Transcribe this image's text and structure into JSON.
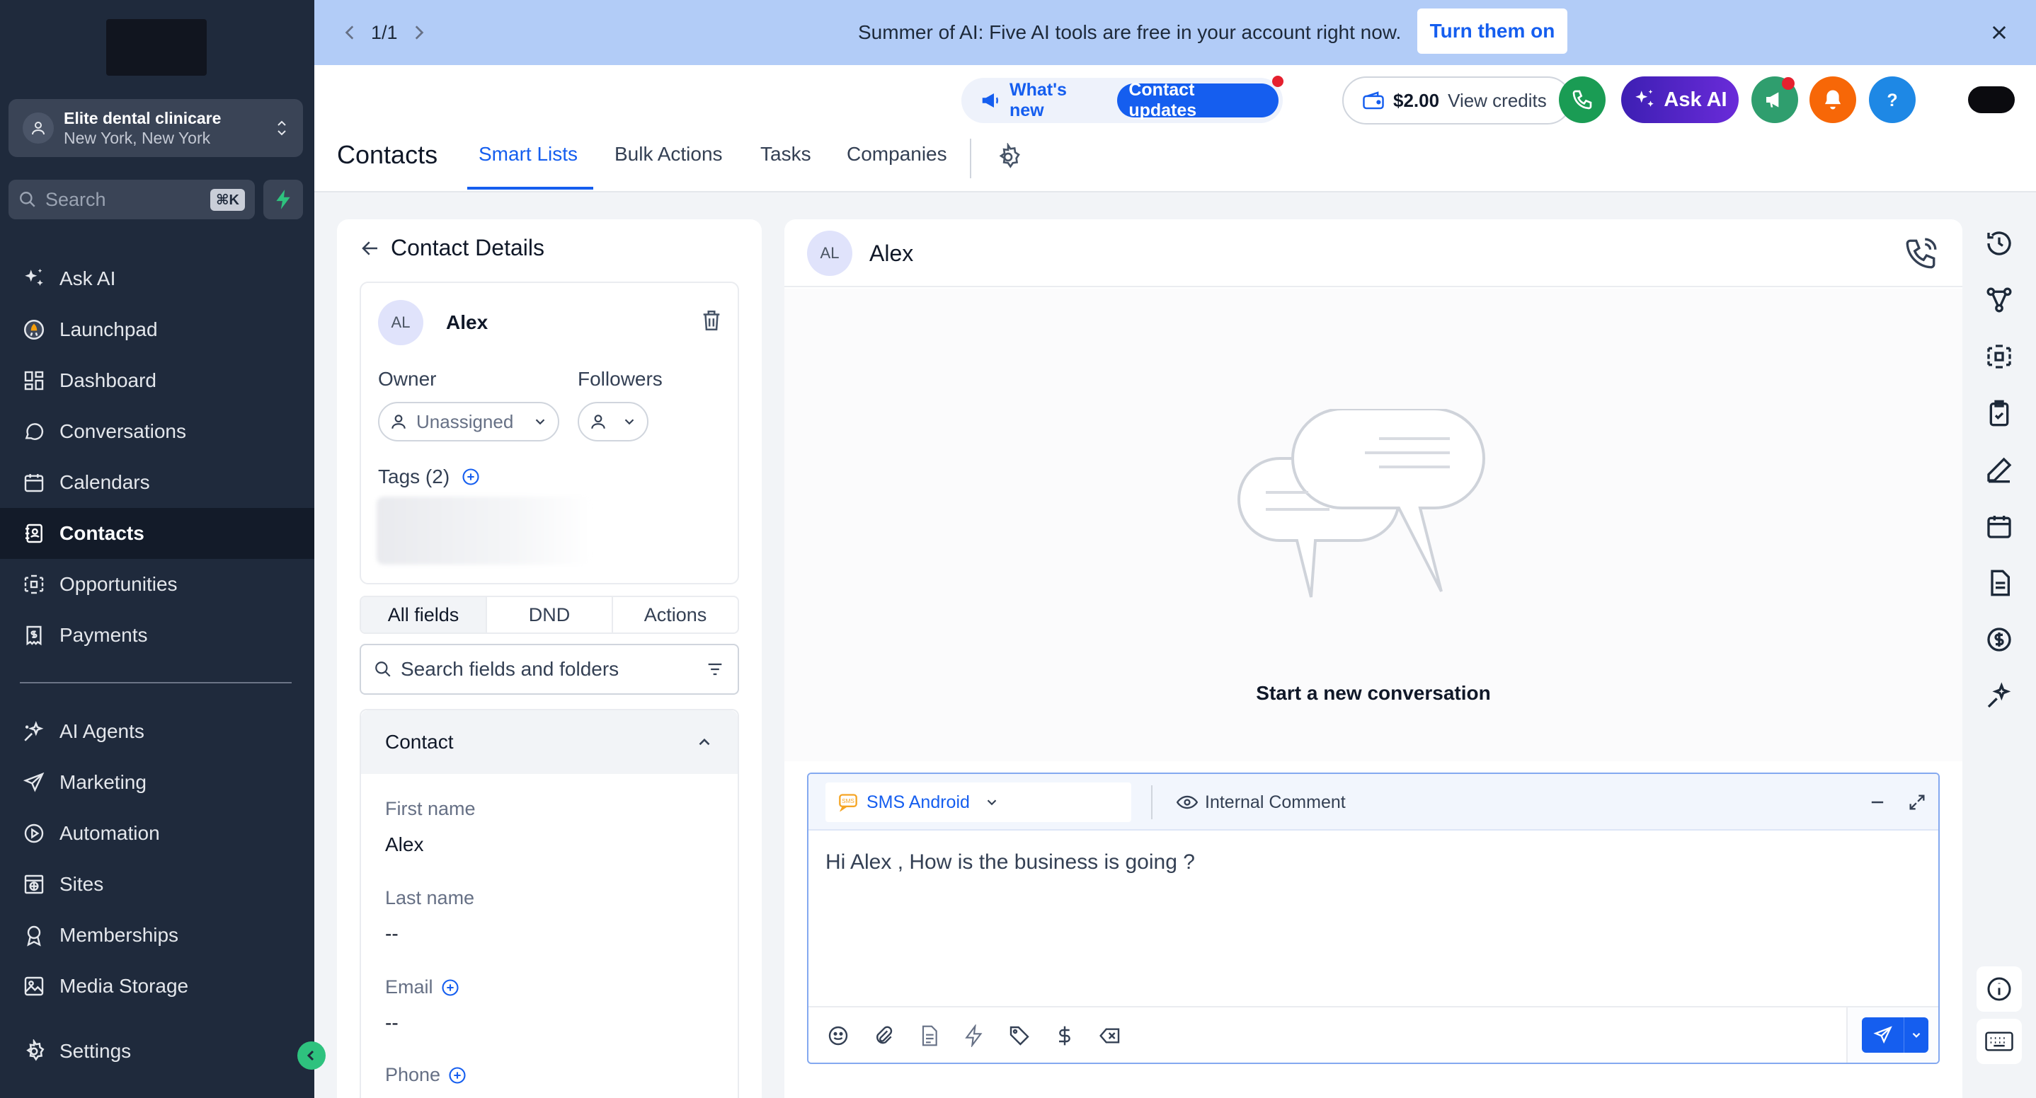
{
  "colors": {
    "sidebar_bg": "#1f2a3c",
    "accent": "#155eef",
    "banner_bg": "#b2ccf7"
  },
  "sidebar": {
    "account": {
      "name": "Elite dental clinicare",
      "location": "New York, New York"
    },
    "search": {
      "placeholder": "Search",
      "shortcut": "⌘K"
    },
    "items": [
      {
        "label": "Ask AI",
        "icon": "sparkle-icon"
      },
      {
        "label": "Launchpad",
        "icon": "launchpad-icon"
      },
      {
        "label": "Dashboard",
        "icon": "dashboard-icon"
      },
      {
        "label": "Conversations",
        "icon": "chat-icon"
      },
      {
        "label": "Calendars",
        "icon": "calendar-icon"
      },
      {
        "label": "Contacts",
        "icon": "contacts-icon",
        "active": true
      },
      {
        "label": "Opportunities",
        "icon": "opportunities-icon"
      },
      {
        "label": "Payments",
        "icon": "payments-icon"
      }
    ],
    "items2": [
      {
        "label": "AI Agents",
        "icon": "ai-agents-icon"
      },
      {
        "label": "Marketing",
        "icon": "send-icon"
      },
      {
        "label": "Automation",
        "icon": "automation-icon"
      },
      {
        "label": "Sites",
        "icon": "sites-icon"
      },
      {
        "label": "Memberships",
        "icon": "memberships-icon"
      },
      {
        "label": "Media Storage",
        "icon": "media-icon"
      }
    ],
    "settings_label": "Settings"
  },
  "banner": {
    "pager": "1/1",
    "message": "Summer of AI: Five AI tools are free in your account right now.",
    "cta": "Turn them on"
  },
  "header": {
    "whats_new": "What's new",
    "contact_updates": "Contact updates",
    "credits_amount": "$2.00",
    "credits_label": "View credits",
    "ask_ai": "Ask AI"
  },
  "nav": {
    "title": "Contacts",
    "tabs": [
      "Smart Lists",
      "Bulk Actions",
      "Tasks",
      "Companies"
    ]
  },
  "contact_details": {
    "title": "Contact Details",
    "initials": "AL",
    "name": "Alex",
    "owner_label": "Owner",
    "owner_value": "Unassigned",
    "followers_label": "Followers",
    "tags_label": "Tags (2)",
    "tabs": [
      "All fields",
      "DND",
      "Actions"
    ],
    "search_placeholder": "Search fields and folders",
    "section_title": "Contact",
    "fields": [
      {
        "label": "First name",
        "value": "Alex"
      },
      {
        "label": "Last name",
        "value": "--"
      },
      {
        "label": "Email",
        "value": "--"
      },
      {
        "label": "Phone",
        "value": ""
      }
    ]
  },
  "conversation": {
    "initials": "AL",
    "name": "Alex",
    "empty_text": "Start a new conversation",
    "channel": "SMS Android",
    "internal_comment": "Internal Comment",
    "draft": "Hi Alex , How is the business is going ?"
  }
}
